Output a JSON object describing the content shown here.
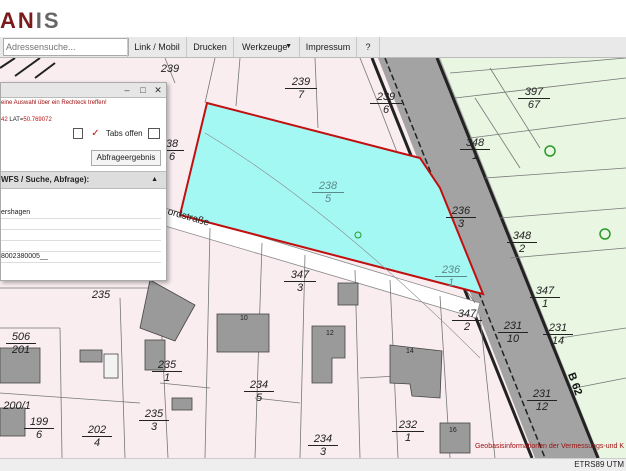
{
  "header": {
    "logo_main": "AN",
    "logo_accent": "IS"
  },
  "toolbar": {
    "search_placeholder": "Adressensuche...",
    "link_mobil": "Link / Mobil",
    "drucken": "Drucken",
    "werkzeuge": "Werkzeuge",
    "impressum": "Impressum",
    "help": "?"
  },
  "panel": {
    "hint": "eine Auswahl über ein Rechteck treffen!",
    "coord_prefix": "42",
    "lat_label": " LAT=",
    "lat_value": "50.769072",
    "tabs_label": "Tabs offen",
    "result_button": "Abfrageergebnis",
    "section_title": "WFS / Suche, Abfrage):",
    "rows": [
      "ershagen",
      "",
      "",
      "",
      "8002380005__"
    ]
  },
  "map": {
    "parcels": [
      {
        "top": "239",
        "bottom": "7"
      },
      {
        "top": "239",
        "bottom": "6"
      },
      {
        "top": "397",
        "bottom": "67"
      },
      {
        "top": "348",
        "bottom": "1"
      },
      {
        "top": "238",
        "bottom": "5"
      },
      {
        "top": "236",
        "bottom": "3"
      },
      {
        "top": "348",
        "bottom": "2"
      },
      {
        "top": "236",
        "bottom": "1"
      },
      {
        "top": "347",
        "bottom": "3"
      },
      {
        "top": "347",
        "bottom": "1"
      },
      {
        "top": "347",
        "bottom": "2"
      },
      {
        "top": "231",
        "bottom": "10"
      },
      {
        "top": "231",
        "bottom": "14"
      },
      {
        "top": "235",
        "bottom": ""
      },
      {
        "top": "506",
        "bottom": "201"
      },
      {
        "top": "235",
        "bottom": "1"
      },
      {
        "top": "234",
        "bottom": "5"
      },
      {
        "top": "200/1",
        "bottom": ""
      },
      {
        "top": "235",
        "bottom": "3"
      },
      {
        "top": "199",
        "bottom": "6"
      },
      {
        "top": "202",
        "bottom": "4"
      },
      {
        "top": "234",
        "bottom": "3"
      },
      {
        "top": "232",
        "bottom": "1"
      },
      {
        "top": "231",
        "bottom": "12"
      },
      {
        "top": "239",
        "bottom": ""
      },
      {
        "top": "38",
        "bottom": "6"
      }
    ],
    "street_name": "ordstraße",
    "road_label": "B 62",
    "building_numbers": [
      "10",
      "12",
      "14",
      "16"
    ],
    "attribution": "Geobasisinformationen der Vermessungs-und K",
    "crs": "ETRS89 UTM"
  },
  "colors": {
    "selection_fill": "#a4f8f4",
    "selection_stroke": "#c01010",
    "green_area": "#e7f6e2",
    "road_gray": "#9a9a9a"
  }
}
